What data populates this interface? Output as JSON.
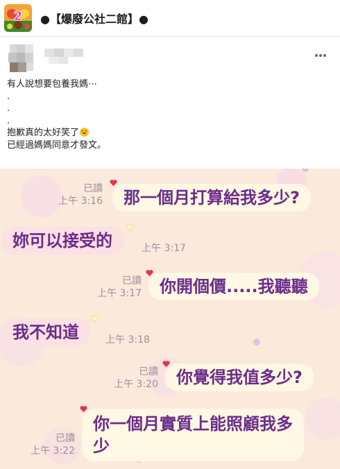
{
  "header": {
    "group_title": "●【爆廢公社二館】●",
    "group_avatar_label": "2",
    "more_label": "…"
  },
  "post": {
    "lines": [
      "有人說想要包養我媽⋯",
      ".",
      ".",
      ".",
      "抱歉真的太好笑了",
      "已經過媽媽同意才發文。"
    ]
  },
  "chat": {
    "messages": [
      {
        "side": "right",
        "text": "那一個月打算給我多少?",
        "read": "已讀",
        "time": "上午 3:16"
      },
      {
        "side": "left",
        "text": "妳可以接受的",
        "time": "上午 3:17"
      },
      {
        "side": "right",
        "text": "你開個價.....我聽聽",
        "read": "已讀",
        "time": "上午 3:17"
      },
      {
        "side": "left",
        "text": "我不知道",
        "time": "上午 3:18"
      },
      {
        "side": "right",
        "text": "你覺得我值多少?",
        "read": "已讀",
        "time": "上午 3:20"
      },
      {
        "side": "right",
        "text_line1": "你一個月實質上能照顧我多",
        "text_line2": "少",
        "read": "已讀",
        "time": "上午 3:22"
      }
    ]
  },
  "colors": {
    "chat_bg": "#fbe9dc",
    "right_bubble": "#fff8e4",
    "left_bubble": "#fbe0e4",
    "chat_text": "#6b2c8a",
    "meta_text": "#9b8f99",
    "heart": "#e3344f"
  }
}
